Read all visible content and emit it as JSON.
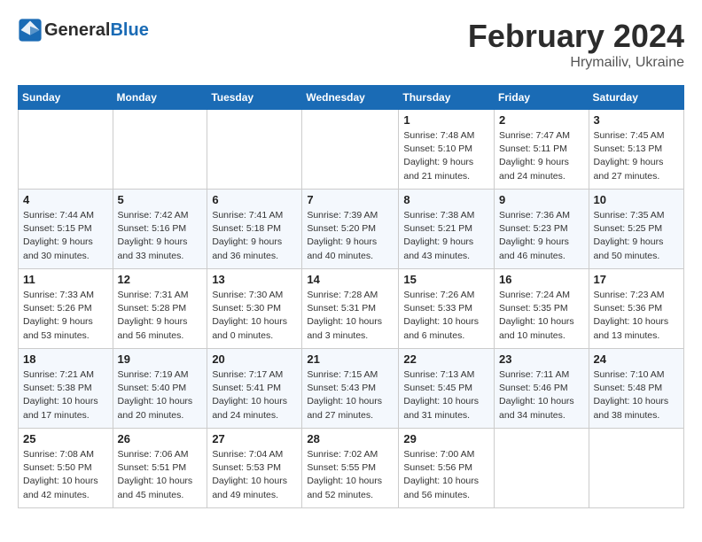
{
  "header": {
    "logo_general": "General",
    "logo_blue": "Blue",
    "month_title": "February 2024",
    "location": "Hrymailiv, Ukraine"
  },
  "weekdays": [
    "Sunday",
    "Monday",
    "Tuesday",
    "Wednesday",
    "Thursday",
    "Friday",
    "Saturday"
  ],
  "weeks": [
    {
      "row_class": "row-week1",
      "days": [
        {
          "num": "",
          "info": "",
          "empty": true
        },
        {
          "num": "",
          "info": "",
          "empty": true
        },
        {
          "num": "",
          "info": "",
          "empty": true
        },
        {
          "num": "",
          "info": "",
          "empty": true
        },
        {
          "num": "1",
          "info": "Sunrise: 7:48 AM\nSunset: 5:10 PM\nDaylight: 9 hours\nand 21 minutes."
        },
        {
          "num": "2",
          "info": "Sunrise: 7:47 AM\nSunset: 5:11 PM\nDaylight: 9 hours\nand 24 minutes."
        },
        {
          "num": "3",
          "info": "Sunrise: 7:45 AM\nSunset: 5:13 PM\nDaylight: 9 hours\nand 27 minutes."
        }
      ]
    },
    {
      "row_class": "row-week2",
      "days": [
        {
          "num": "4",
          "info": "Sunrise: 7:44 AM\nSunset: 5:15 PM\nDaylight: 9 hours\nand 30 minutes."
        },
        {
          "num": "5",
          "info": "Sunrise: 7:42 AM\nSunset: 5:16 PM\nDaylight: 9 hours\nand 33 minutes."
        },
        {
          "num": "6",
          "info": "Sunrise: 7:41 AM\nSunset: 5:18 PM\nDaylight: 9 hours\nand 36 minutes."
        },
        {
          "num": "7",
          "info": "Sunrise: 7:39 AM\nSunset: 5:20 PM\nDaylight: 9 hours\nand 40 minutes."
        },
        {
          "num": "8",
          "info": "Sunrise: 7:38 AM\nSunset: 5:21 PM\nDaylight: 9 hours\nand 43 minutes."
        },
        {
          "num": "9",
          "info": "Sunrise: 7:36 AM\nSunset: 5:23 PM\nDaylight: 9 hours\nand 46 minutes."
        },
        {
          "num": "10",
          "info": "Sunrise: 7:35 AM\nSunset: 5:25 PM\nDaylight: 9 hours\nand 50 minutes."
        }
      ]
    },
    {
      "row_class": "row-week3",
      "days": [
        {
          "num": "11",
          "info": "Sunrise: 7:33 AM\nSunset: 5:26 PM\nDaylight: 9 hours\nand 53 minutes."
        },
        {
          "num": "12",
          "info": "Sunrise: 7:31 AM\nSunset: 5:28 PM\nDaylight: 9 hours\nand 56 minutes."
        },
        {
          "num": "13",
          "info": "Sunrise: 7:30 AM\nSunset: 5:30 PM\nDaylight: 10 hours\nand 0 minutes."
        },
        {
          "num": "14",
          "info": "Sunrise: 7:28 AM\nSunset: 5:31 PM\nDaylight: 10 hours\nand 3 minutes."
        },
        {
          "num": "15",
          "info": "Sunrise: 7:26 AM\nSunset: 5:33 PM\nDaylight: 10 hours\nand 6 minutes."
        },
        {
          "num": "16",
          "info": "Sunrise: 7:24 AM\nSunset: 5:35 PM\nDaylight: 10 hours\nand 10 minutes."
        },
        {
          "num": "17",
          "info": "Sunrise: 7:23 AM\nSunset: 5:36 PM\nDaylight: 10 hours\nand 13 minutes."
        }
      ]
    },
    {
      "row_class": "row-week4",
      "days": [
        {
          "num": "18",
          "info": "Sunrise: 7:21 AM\nSunset: 5:38 PM\nDaylight: 10 hours\nand 17 minutes."
        },
        {
          "num": "19",
          "info": "Sunrise: 7:19 AM\nSunset: 5:40 PM\nDaylight: 10 hours\nand 20 minutes."
        },
        {
          "num": "20",
          "info": "Sunrise: 7:17 AM\nSunset: 5:41 PM\nDaylight: 10 hours\nand 24 minutes."
        },
        {
          "num": "21",
          "info": "Sunrise: 7:15 AM\nSunset: 5:43 PM\nDaylight: 10 hours\nand 27 minutes."
        },
        {
          "num": "22",
          "info": "Sunrise: 7:13 AM\nSunset: 5:45 PM\nDaylight: 10 hours\nand 31 minutes."
        },
        {
          "num": "23",
          "info": "Sunrise: 7:11 AM\nSunset: 5:46 PM\nDaylight: 10 hours\nand 34 minutes."
        },
        {
          "num": "24",
          "info": "Sunrise: 7:10 AM\nSunset: 5:48 PM\nDaylight: 10 hours\nand 38 minutes."
        }
      ]
    },
    {
      "row_class": "row-week5",
      "days": [
        {
          "num": "25",
          "info": "Sunrise: 7:08 AM\nSunset: 5:50 PM\nDaylight: 10 hours\nand 42 minutes."
        },
        {
          "num": "26",
          "info": "Sunrise: 7:06 AM\nSunset: 5:51 PM\nDaylight: 10 hours\nand 45 minutes."
        },
        {
          "num": "27",
          "info": "Sunrise: 7:04 AM\nSunset: 5:53 PM\nDaylight: 10 hours\nand 49 minutes."
        },
        {
          "num": "28",
          "info": "Sunrise: 7:02 AM\nSunset: 5:55 PM\nDaylight: 10 hours\nand 52 minutes."
        },
        {
          "num": "29",
          "info": "Sunrise: 7:00 AM\nSunset: 5:56 PM\nDaylight: 10 hours\nand 56 minutes."
        },
        {
          "num": "",
          "info": "",
          "empty": true
        },
        {
          "num": "",
          "info": "",
          "empty": true
        }
      ]
    }
  ]
}
